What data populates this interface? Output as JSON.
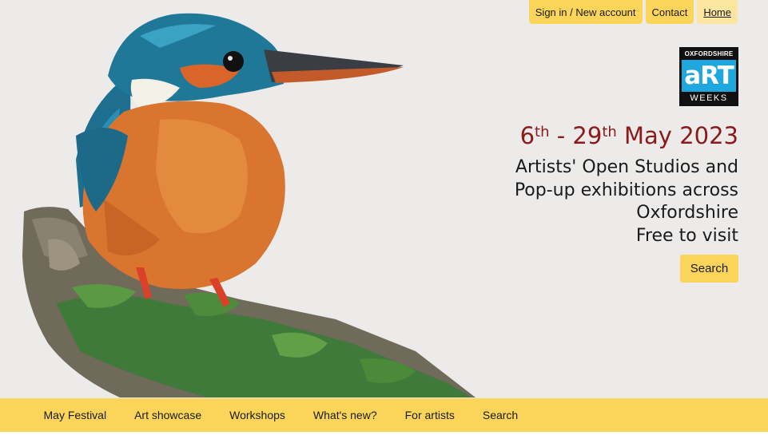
{
  "top_nav": {
    "sign_in": "Sign in / New account",
    "contact": "Contact",
    "home": "Home"
  },
  "logo": {
    "line1": "OXFORDSHIRE",
    "line2": "aRT",
    "line3": "WEEKS"
  },
  "hero": {
    "date_start_day": "6",
    "date_start_suffix": "th",
    "date_sep": " - ",
    "date_end_day": "29",
    "date_end_suffix": "th",
    "date_rest": " May 2023",
    "tagline_lines": [
      "Artists' Open Studios and",
      "Pop-up exhibitions across",
      "Oxfordshire",
      "Free to visit"
    ],
    "search_label": "Search",
    "image_icon": "kingfisher-illustration"
  },
  "bottom_nav": {
    "items": [
      "May Festival",
      "Art showcase",
      "Workshops",
      "What's new?",
      "For artists",
      "Search"
    ]
  },
  "colors": {
    "accent": "#fbd55a",
    "date_color": "#8b1a1a",
    "logo_blue": "#1fa8df",
    "background": "#ecebea"
  }
}
